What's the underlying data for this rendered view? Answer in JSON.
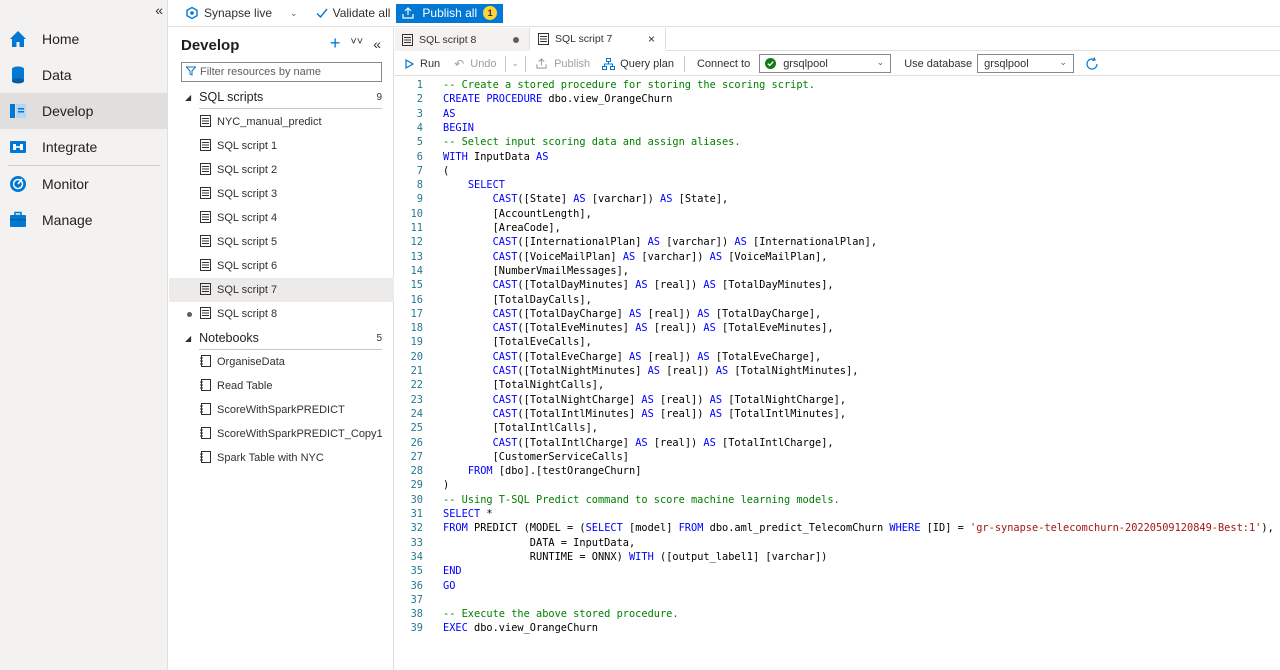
{
  "nav": {
    "items": [
      {
        "label": "Home",
        "icon": "home-icon"
      },
      {
        "label": "Data",
        "icon": "data-icon"
      },
      {
        "label": "Develop",
        "icon": "develop-icon"
      },
      {
        "label": "Integrate",
        "icon": "integrate-icon"
      },
      {
        "label": "Monitor",
        "icon": "monitor-icon"
      },
      {
        "label": "Manage",
        "icon": "manage-icon"
      }
    ],
    "active": "Develop",
    "collapse_glyph": "«"
  },
  "topbar": {
    "workspace": "Synapse live",
    "validate_all": "Validate all",
    "publish_all": "Publish all",
    "publish_count": "1"
  },
  "develop": {
    "title": "Develop",
    "filter_placeholder": "Filter resources by name",
    "sql_group": {
      "label": "SQL scripts",
      "count": "9"
    },
    "sql_items": [
      "NYC_manual_predict",
      "SQL script 1",
      "SQL script 2",
      "SQL script 3",
      "SQL script 4",
      "SQL script 5",
      "SQL script 6",
      "SQL script 7",
      "SQL script 8"
    ],
    "selected_item": "SQL script 7",
    "unsaved_item": "SQL script 8",
    "nb_group": {
      "label": "Notebooks",
      "count": "5"
    },
    "nb_items": [
      "OrganiseData",
      "Read Table",
      "ScoreWithSparkPREDICT",
      "ScoreWithSparkPREDICT_Copy1",
      "Spark Table with NYC"
    ]
  },
  "tabs": [
    {
      "label": "SQL script 8",
      "state": "unsaved"
    },
    {
      "label": "SQL script 7",
      "state": "active"
    }
  ],
  "toolbar": {
    "run": "Run",
    "undo": "Undo",
    "publish": "Publish",
    "query_plan": "Query plan",
    "connect_to_label": "Connect to",
    "connect_to_value": "grsqlpool",
    "use_database_label": "Use database",
    "use_database_value": "grsqlpool"
  },
  "code": {
    "line_numbers": [
      "1",
      "2",
      "3",
      "4",
      "5",
      "6",
      "7",
      "8",
      "9",
      "10",
      "11",
      "12",
      "13",
      "14",
      "15",
      "16",
      "17",
      "18",
      "19",
      "20",
      "21",
      "22",
      "23",
      "24",
      "25",
      "26",
      "27",
      "28",
      "29",
      "30",
      "31",
      "32",
      "33",
      "34",
      "35",
      "36",
      "37",
      "38",
      "39"
    ],
    "lines": [
      "-- Create a stored procedure for storing the scoring script.",
      "CREATE PROCEDURE dbo.view_OrangeChurn",
      "AS",
      "BEGIN",
      "-- Select input scoring data and assign aliases.",
      "WITH InputData AS",
      "(",
      "    SELECT",
      "        CAST([State] AS [varchar]) AS [State],",
      "        [AccountLength],",
      "        [AreaCode],",
      "        CAST([InternationalPlan] AS [varchar]) AS [InternationalPlan],",
      "        CAST([VoiceMailPlan] AS [varchar]) AS [VoiceMailPlan],",
      "        [NumberVmailMessages],",
      "        CAST([TotalDayMinutes] AS [real]) AS [TotalDayMinutes],",
      "        [TotalDayCalls],",
      "        CAST([TotalDayCharge] AS [real]) AS [TotalDayCharge],",
      "        CAST([TotalEveMinutes] AS [real]) AS [TotalEveMinutes],",
      "        [TotalEveCalls],",
      "        CAST([TotalEveCharge] AS [real]) AS [TotalEveCharge],",
      "        CAST([TotalNightMinutes] AS [real]) AS [TotalNightMinutes],",
      "        [TotalNightCalls],",
      "        CAST([TotalNightCharge] AS [real]) AS [TotalNightCharge],",
      "        CAST([TotalIntlMinutes] AS [real]) AS [TotalIntlMinutes],",
      "        [TotalIntlCalls],",
      "        CAST([TotalIntlCharge] AS [real]) AS [TotalIntlCharge],",
      "        [CustomerServiceCalls]",
      "    FROM [dbo].[testOrangeChurn]",
      ")",
      "-- Using T-SQL Predict command to score machine learning models.",
      "SELECT *",
      "FROM PREDICT (MODEL = (SELECT [model] FROM dbo.aml_predict_TelecomChurn WHERE [ID] = 'gr-synapse-telecomchurn-20220509120849-Best:1'),",
      "              DATA = InputData,",
      "              RUNTIME = ONNX) WITH ([output_label1] [varchar])",
      "END",
      "GO",
      "",
      "-- Execute the above stored procedure.",
      "EXEC dbo.view_OrangeChurn"
    ]
  }
}
